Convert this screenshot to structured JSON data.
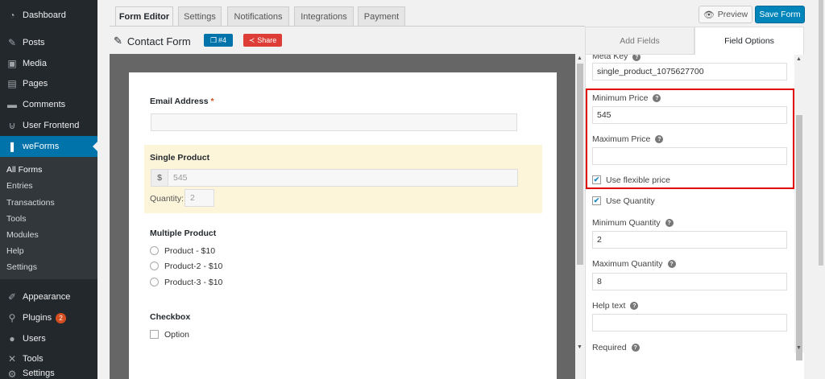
{
  "sidebar": {
    "items": [
      {
        "label": "Dashboard",
        "icon": "dashboard-icon"
      },
      {
        "label": "Posts",
        "icon": "pin-icon"
      },
      {
        "label": "Media",
        "icon": "media-icon"
      },
      {
        "label": "Pages",
        "icon": "pages-icon"
      },
      {
        "label": "Comments",
        "icon": "comment-icon"
      },
      {
        "label": "User Frontend",
        "icon": "user-frontend-icon"
      },
      {
        "label": "weForms",
        "icon": "weforms-icon"
      }
    ],
    "submenu": [
      "All Forms",
      "Entries",
      "Transactions",
      "Tools",
      "Modules",
      "Help",
      "Settings"
    ],
    "bottom_items": [
      {
        "label": "Appearance",
        "icon": "brush-icon"
      },
      {
        "label": "Plugins",
        "icon": "plugin-icon",
        "badge": "2"
      },
      {
        "label": "Users",
        "icon": "users-icon"
      },
      {
        "label": "Tools",
        "icon": "wrench-icon"
      },
      {
        "label": "Settings",
        "icon": "settings-icon"
      }
    ]
  },
  "tabs": [
    "Form Editor",
    "Settings",
    "Notifications",
    "Integrations",
    "Payment"
  ],
  "toolbar": {
    "preview_label": "Preview",
    "save_label": "Save Form"
  },
  "form": {
    "title": "Contact Form",
    "id_label": "#4",
    "share_label": "Share"
  },
  "canvas": {
    "email_label": "Email Address",
    "required_mark": "*",
    "single_product_label": "Single Product",
    "currency": "$",
    "price_value": "545",
    "quantity_label": "Quantity:",
    "quantity_value": "2",
    "multiple_product_label": "Multiple Product",
    "products": [
      "Product - $10",
      "Product-2 - $10",
      "Product-3 - $10"
    ],
    "checkbox_label": "Checkbox",
    "checkbox_option": "Option"
  },
  "panel": {
    "tabs": [
      "Add Fields",
      "Field Options"
    ],
    "meta_key_label": "Meta Key",
    "meta_key_value": "single_product_1075627700",
    "min_price_label": "Minimum Price",
    "min_price_value": "545",
    "max_price_label": "Maximum Price",
    "max_price_value": "",
    "flexible_price_label": "Use flexible price",
    "use_quantity_label": "Use Quantity",
    "min_qty_label": "Minimum Quantity",
    "min_qty_value": "2",
    "max_qty_label": "Maximum Quantity",
    "max_qty_value": "8",
    "help_text_label": "Help text",
    "help_text_value": "",
    "required_label": "Required"
  },
  "colors": {
    "accent": "#0073aa",
    "highlight": "#e00000",
    "share": "#dd3d36"
  }
}
